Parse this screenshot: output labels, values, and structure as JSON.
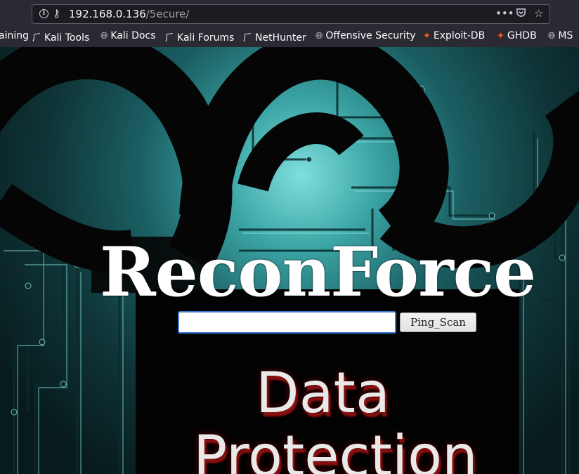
{
  "browser": {
    "url_host": "192.168.0.136",
    "url_path": "/5ecure/",
    "icons": [
      "info-icon",
      "key-icon",
      "more-icon",
      "pocket-icon",
      "star-icon"
    ],
    "bookmarks": [
      {
        "label": "aining",
        "icon": ""
      },
      {
        "label": "Kali Tools",
        "icon": "kali-dragon-icon"
      },
      {
        "label": "Kali Docs",
        "icon": "globe-icon"
      },
      {
        "label": "Kali Forums",
        "icon": "kali-dragon-icon"
      },
      {
        "label": "NetHunter",
        "icon": "kali-dragon-icon"
      },
      {
        "label": "Offensive Security",
        "icon": "globe-icon"
      },
      {
        "label": "Exploit-DB",
        "icon": "exploit-db-icon"
      },
      {
        "label": "GHDB",
        "icon": "exploit-db-icon"
      },
      {
        "label": "MS",
        "icon": "globe-icon"
      }
    ]
  },
  "page": {
    "title": "ReconForce",
    "input_value": "",
    "button_label": "Ping_Scan",
    "banner_line1": "Data",
    "banner_line2": "Protection",
    "colors": {
      "circuit": "#3aa3a3",
      "button_border": "#3a7bd5",
      "banner_shadow": "#8a0f0f"
    }
  }
}
